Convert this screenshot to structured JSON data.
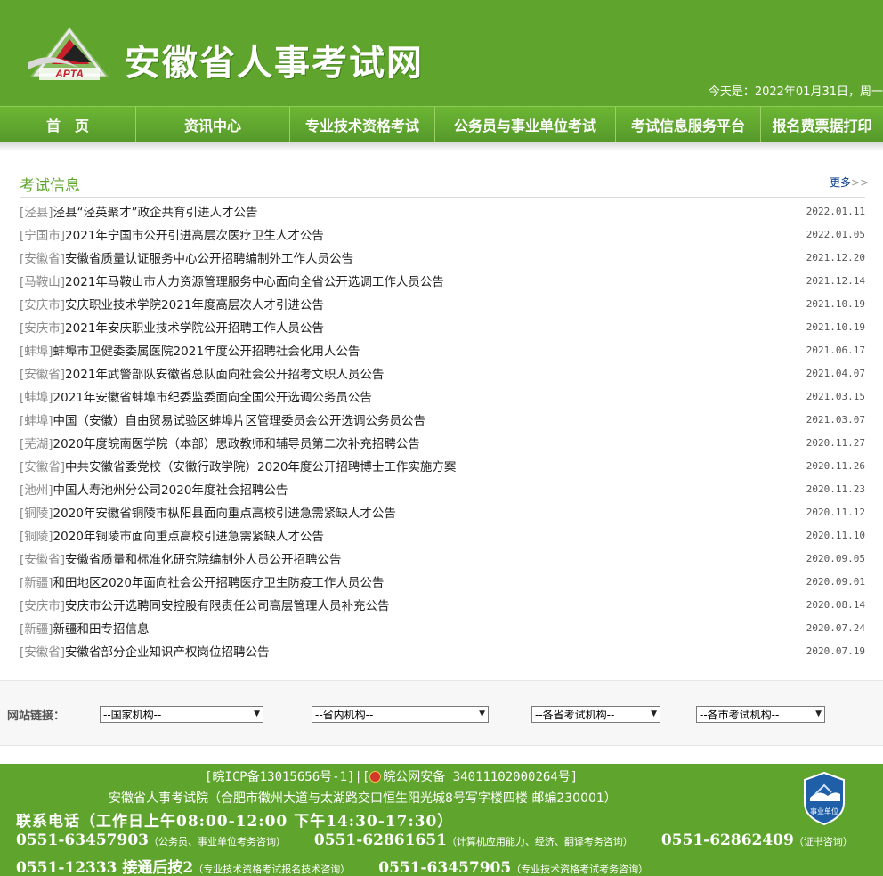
{
  "header": {
    "logo_text": "APTA",
    "site_title": "安徽省人事考试网",
    "date_line": "今天是：2022年01月31日，周一"
  },
  "nav": [
    {
      "label": "首　页"
    },
    {
      "label": "资讯中心"
    },
    {
      "label": "专业技术资格考试"
    },
    {
      "label": "公务员与事业单位考试"
    },
    {
      "label": "考试信息服务平台"
    },
    {
      "label": "报名费票据打印"
    }
  ],
  "exam_info": {
    "title": "考试信息",
    "more_label": "更多",
    "more_arrows": ">>",
    "items": [
      {
        "region": "[泾县]",
        "title": "泾县“泾英聚才”政企共育引进人才公告",
        "date": "2022.01.11"
      },
      {
        "region": "[宁国市]",
        "title": "2021年宁国市公开引进高层次医疗卫生人才公告",
        "date": "2022.01.05"
      },
      {
        "region": "[安徽省]",
        "title": "安徽省质量认证服务中心公开招聘编制外工作人员公告",
        "date": "2021.12.20"
      },
      {
        "region": "[马鞍山]",
        "title": "2021年马鞍山市人力资源管理服务中心面向全省公开选调工作人员公告",
        "date": "2021.12.14"
      },
      {
        "region": "[安庆市]",
        "title": "安庆职业技术学院2021年度高层次人才引进公告",
        "date": "2021.10.19"
      },
      {
        "region": "[安庆市]",
        "title": "2021年安庆职业技术学院公开招聘工作人员公告",
        "date": "2021.10.19"
      },
      {
        "region": "[蚌埠]",
        "title": "蚌埠市卫健委委属医院2021年度公开招聘社会化用人公告",
        "date": "2021.06.17"
      },
      {
        "region": "[安徽省]",
        "title": "2021年武警部队安徽省总队面向社会公开招考文职人员公告",
        "date": "2021.04.07"
      },
      {
        "region": "[蚌埠]",
        "title": "2021年安徽省蚌埠市纪委监委面向全国公开选调公务员公告",
        "date": "2021.03.15"
      },
      {
        "region": "[蚌埠]",
        "title": "中国（安徽）自由贸易试验区蚌埠片区管理委员会公开选调公务员公告",
        "date": "2021.03.07"
      },
      {
        "region": "[芜湖]",
        "title": "2020年度皖南医学院（本部）思政教师和辅导员第二次补充招聘公告",
        "date": "2020.11.27"
      },
      {
        "region": "[安徽省]",
        "title": "中共安徽省委党校（安徽行政学院）2020年度公开招聘博士工作实施方案",
        "date": "2020.11.26"
      },
      {
        "region": "[池州]",
        "title": "中国人寿池州分公司2020年度社会招聘公告",
        "date": "2020.11.23"
      },
      {
        "region": "[铜陵]",
        "title": "2020年安徽省铜陵市枞阳县面向重点高校引进急需紧缺人才公告",
        "date": "2020.11.12"
      },
      {
        "region": "[铜陵]",
        "title": "2020年铜陵市面向重点高校引进急需紧缺人才公告",
        "date": "2020.11.10"
      },
      {
        "region": "[安徽省]",
        "title": "安徽省质量和标准化研究院编制外人员公开招聘公告",
        "date": "2020.09.05"
      },
      {
        "region": "[新疆]",
        "title": "和田地区2020年面向社会公开招聘医疗卫生防疫工作人员公告",
        "date": "2020.09.01"
      },
      {
        "region": "[安庆市]",
        "title": "安庆市公开选聘同安控股有限责任公司高层管理人员补充公告",
        "date": "2020.08.14"
      },
      {
        "region": "[新疆]",
        "title": "新疆和田专招信息",
        "date": "2020.07.24"
      },
      {
        "region": "[安徽省]",
        "title": "安徽省部分企业知识产权岗位招聘公告",
        "date": "2020.07.19"
      }
    ]
  },
  "links": {
    "label": "网站链接：",
    "selects": [
      {
        "selected": "--国家机构--"
      },
      {
        "selected": "--省内机构--"
      },
      {
        "selected": "--各省考试机构--"
      },
      {
        "selected": "--各市考试机构--"
      }
    ]
  },
  "footer": {
    "icp_prefix": "[皖ICP备13015656号-1]|[",
    "icp_suffix": "皖公网安备 34011102000264号]",
    "address": "安徽省人事考试院（合肥市徽州大道与太湖路交口恒生阳光城8号写字楼四楼 邮编230001）",
    "hotline": "联系电话（工作日上午08:00-12:00 下午14:30-17:30）",
    "phones_row1": [
      {
        "number": "0551-63457903",
        "note": "（公务员、事业单位考务咨询）"
      },
      {
        "number": "0551-62861651",
        "note": "（计算机应用能力、经济、翻译考务咨询）"
      },
      {
        "number": "0551-62862409",
        "note": "（证书咨询）"
      }
    ],
    "phones_row2": [
      {
        "number": "0551-12333 接通后按2",
        "note": "（专业技术资格考试报名技术咨询）"
      },
      {
        "number": "0551-63457905",
        "note": "（专业技术资格考试考务咨询）"
      }
    ],
    "org_badge_text": "事业单位"
  },
  "colors": {
    "brand_green": "#5fa52d",
    "section_title": "#5fa52d",
    "more_link": "#003a8c",
    "region_gray": "#8a8a8a"
  }
}
